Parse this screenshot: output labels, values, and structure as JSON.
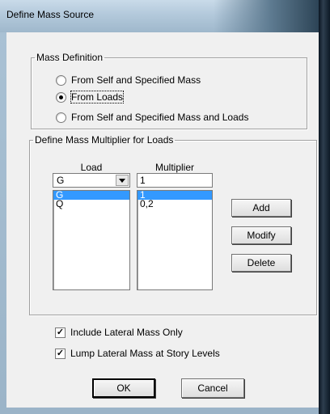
{
  "window": {
    "title": "Define Mass Source"
  },
  "mass_definition": {
    "legend": "Mass Definition",
    "options": [
      {
        "label": "From Self and Specified Mass",
        "checked": false
      },
      {
        "label": "From Loads",
        "checked": true
      },
      {
        "label": "From Self and Specified Mass and Loads",
        "checked": false
      }
    ]
  },
  "multiplier_group": {
    "legend": "Define Mass Multiplier for Loads",
    "load_header": "Load",
    "multiplier_header": "Multiplier",
    "load_select_value": "G",
    "multiplier_input_value": "1",
    "rows": [
      {
        "load": "G",
        "multiplier": "1",
        "selected": true
      },
      {
        "load": "Q",
        "multiplier": "0,2",
        "selected": false
      }
    ],
    "add_label": "Add",
    "modify_label": "Modify",
    "delete_label": "Delete"
  },
  "options": {
    "lateral_only": {
      "label": "Include Lateral Mass Only",
      "checked": true
    },
    "lump_story": {
      "label": "Lump Lateral Mass at Story Levels",
      "checked": true
    }
  },
  "footer": {
    "ok_label": "OK",
    "cancel_label": "Cancel"
  }
}
